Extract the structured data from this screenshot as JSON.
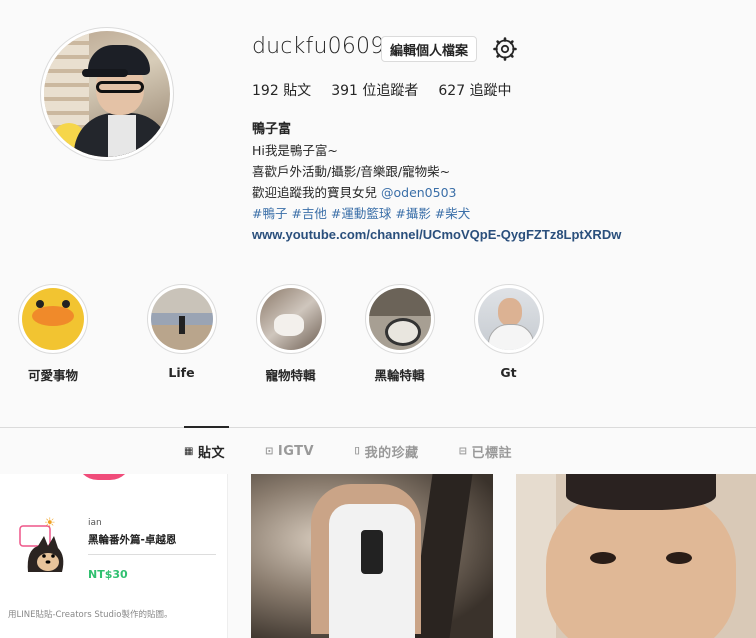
{
  "profile": {
    "username": "duckfu0609",
    "edit_label": "編輯個人檔案",
    "stats": {
      "posts_num": "192",
      "posts_label": "貼文",
      "followers_num": "391",
      "followers_label": "位追蹤者",
      "following_num": "627",
      "following_label": "追蹤中"
    },
    "bio": {
      "name": "鴨子富",
      "line1": "Hi我是鴨子富~",
      "line2": "喜歡戶外活動/攝影/音樂跟/寵物柴~",
      "line3_text": "歡迎追蹤我的寶貝女兒 ",
      "line3_mention": "@oden0503",
      "hashtags": "#鴨子 #吉他 #運動籃球 #攝影 #柴犬",
      "url": "www.youtube.com/channel/UCmoVQpE-QygFZTz8LptXRDw"
    }
  },
  "highlights": [
    {
      "label": "可愛事物",
      "icon": "duck-face"
    },
    {
      "label": "Life",
      "icon": "basketball-court"
    },
    {
      "label": "寵物特輯",
      "icon": "pet-bath"
    },
    {
      "label": "黑輪特輯",
      "icon": "dog-wheel"
    },
    {
      "label": "Gt",
      "icon": "portrait"
    }
  ],
  "tabs": [
    {
      "label": "貼文",
      "icon": "grid-icon",
      "active": true
    },
    {
      "label": "IGTV",
      "icon": "igtv-icon",
      "active": false
    },
    {
      "label": "我的珍藏",
      "icon": "bookmark-icon",
      "active": false
    },
    {
      "label": "已標註",
      "icon": "tag-icon",
      "active": false
    }
  ],
  "posts": {
    "sticker": {
      "author": "ian",
      "title": "黑輪番外篇-卓越恩",
      "price": "NT$30",
      "footer": "用LINE貼貼-Creators Studio製作的貼圖。"
    }
  },
  "colors": {
    "background": "#fafafa",
    "link": "#3b6fa8",
    "url": "#2a4f7c",
    "price": "#30c070",
    "border": "#dbdbdb"
  }
}
